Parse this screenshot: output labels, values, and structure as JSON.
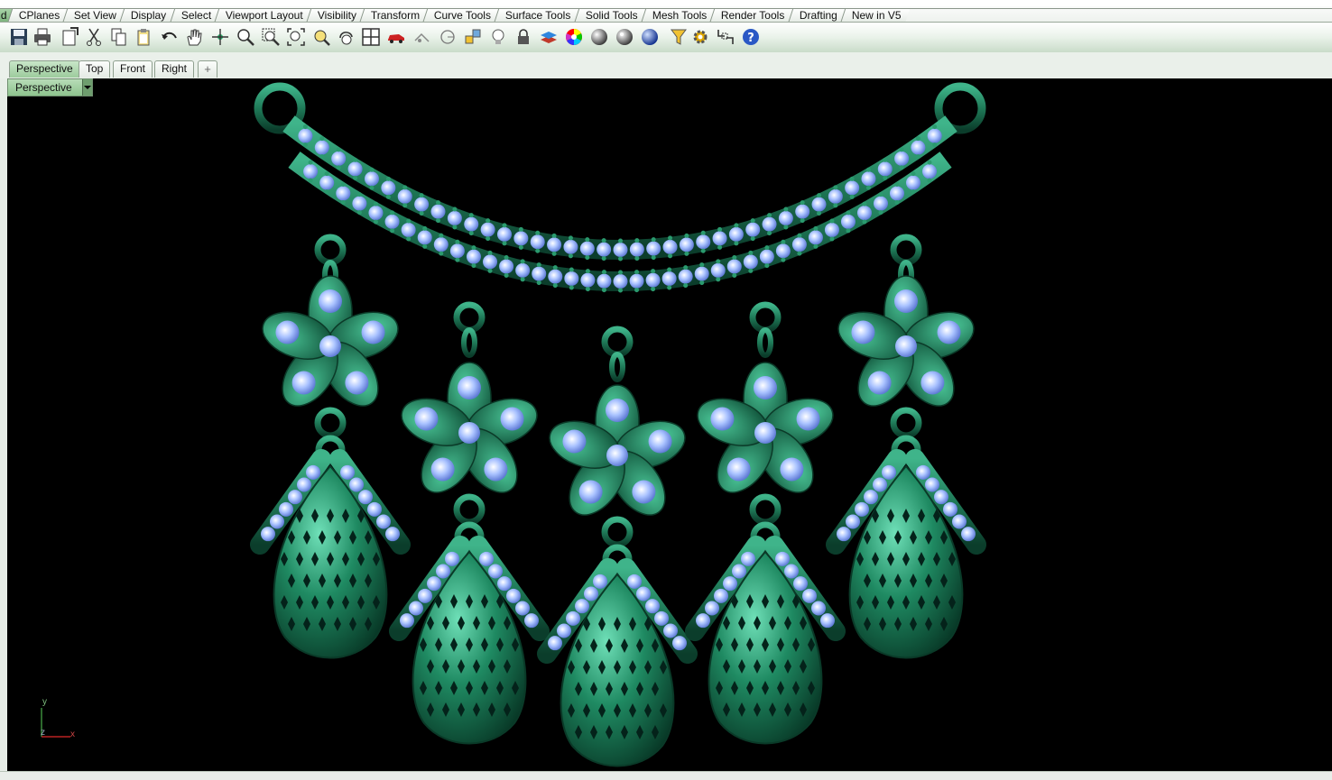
{
  "menu_tabs": {
    "first": "d",
    "items": [
      "CPlanes",
      "Set View",
      "Display",
      "Select",
      "Viewport Layout",
      "Visibility",
      "Transform",
      "Curve Tools",
      "Surface Tools",
      "Solid Tools",
      "Mesh Tools",
      "Render Tools",
      "Drafting",
      "New in V5"
    ]
  },
  "toolbar": {
    "icons": [
      "save-icon",
      "print-icon",
      "page-setup-icon",
      "cut-icon",
      "copy-icon",
      "paste-icon",
      "undo-icon",
      "pan-hand-icon",
      "rotate-view-icon",
      "zoom-icon",
      "zoom-window-icon",
      "zoom-extents-icon",
      "zoom-selected-icon",
      "undo-view-icon",
      "four-viewports-icon",
      "car-icon",
      "camera-icon",
      "circle-tool-icon",
      "shape-tool-icon",
      "light-bulb-icon",
      "lock-icon",
      "layer-icon",
      "color-wheel-icon",
      "shaded-sphere-icon",
      "rendered-sphere-icon",
      "render-icon",
      "filter-icon",
      "settings-gear-icon",
      "dimension-icon",
      "help-icon"
    ]
  },
  "viewport_tabs": {
    "items": [
      "Perspective",
      "Top",
      "Front",
      "Right"
    ],
    "active": "Perspective",
    "add_symbol": "+"
  },
  "viewport": {
    "title": "Perspective",
    "axis_x": "x",
    "axis_y": "y",
    "axis_z": "z",
    "metal_color": "#1f7a58",
    "gem_color": "#8fb0f0"
  }
}
